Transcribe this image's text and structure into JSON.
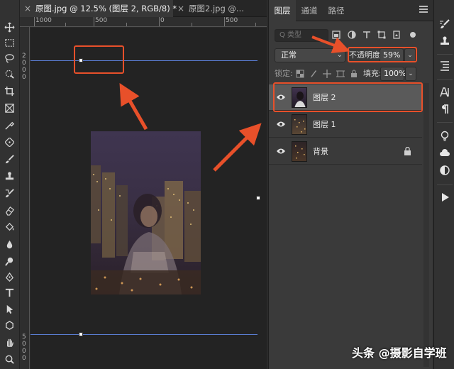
{
  "document_tabs": [
    {
      "title": "原图.jpg @ 12.5% (图层 2, RGB/8) *",
      "close": "×"
    },
    {
      "title": "原图2.jpg @...",
      "close": "×"
    }
  ],
  "ruler": {
    "top_labels": [
      "1000",
      "500",
      "0",
      "500"
    ],
    "left_labels": [
      "2",
      "0",
      "0",
      "0",
      "5",
      "0",
      "0",
      "0"
    ]
  },
  "panel": {
    "tabs": [
      "图层",
      "通道",
      "路径"
    ],
    "search_placeholder": "Q 类型",
    "blend_mode": "正常",
    "opacity_label": "不透明度:",
    "opacity_value": "59%",
    "lock_label": "锁定:",
    "fill_label": "填充:",
    "fill_value": "100%",
    "layers": [
      {
        "name": "图层 2",
        "selected": true,
        "locked": false
      },
      {
        "name": "图层 1",
        "selected": false,
        "locked": false
      },
      {
        "name": "背景",
        "selected": false,
        "locked": true
      }
    ]
  },
  "icons": {
    "tools": [
      "move-icon",
      "marquee-icon",
      "lasso-icon",
      "quick-select-icon",
      "crop-icon",
      "frame-icon",
      "eyedropper-icon",
      "healing-icon",
      "brush-icon",
      "stamp-icon",
      "history-brush-icon",
      "eraser-icon",
      "bucket-icon",
      "blur-icon",
      "dodge-icon",
      "pen-icon",
      "type-icon",
      "path-select-icon",
      "shape-icon",
      "hand-icon",
      "zoom-icon"
    ],
    "strip": [
      "brush-settings-icon",
      "clone-source-icon",
      "paragraph-icon",
      "character-icon",
      "pilcrow-icon",
      "light-icon",
      "libraries-icon",
      "adjustments-icon",
      "play-icon"
    ]
  },
  "colors": {
    "accent_red": "#e8502a",
    "guide_blue": "#5b7fd6",
    "selected_layer": "#5a5a5a"
  },
  "watermark": "头条 @摄影自学班"
}
